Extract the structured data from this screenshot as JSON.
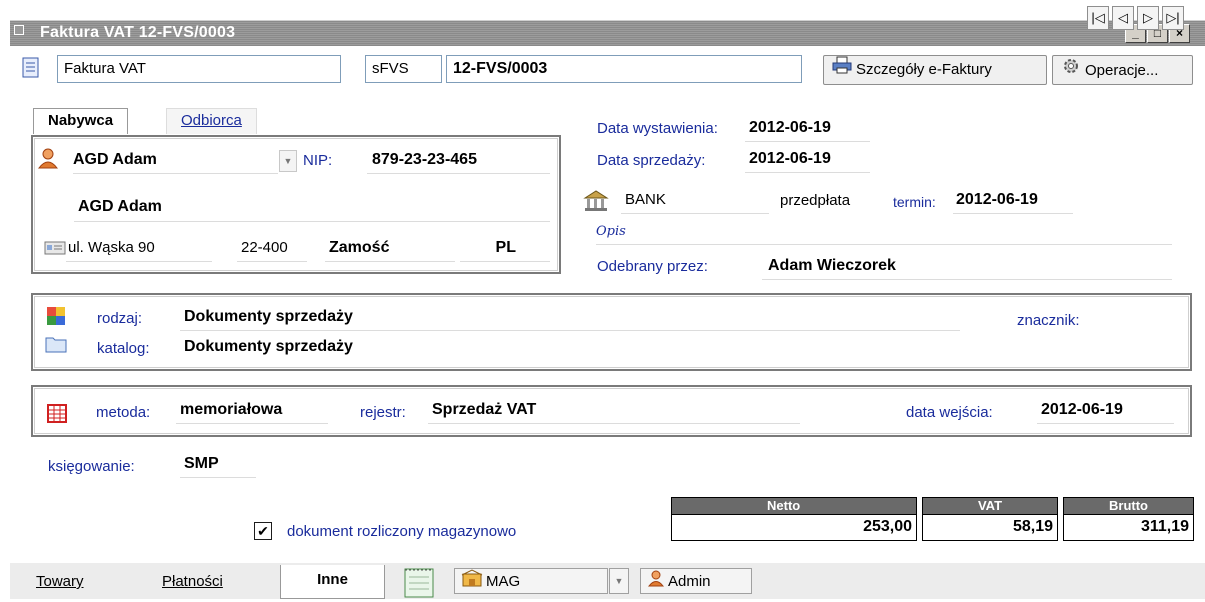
{
  "window": {
    "title": "Faktura VAT 12-FVS/0003",
    "buttons": [
      "_",
      "□",
      "×"
    ]
  },
  "toolbar": {
    "doc_type": "Faktura VAT",
    "series": "sFVS",
    "number": "12-FVS/0003",
    "efaktura_label": "Szczegóły e-Faktury",
    "operations_label": "Operacje..."
  },
  "party_tabs": [
    "Nabywca",
    "Odbiorca"
  ],
  "buyer": {
    "name_select": "AGD Adam",
    "nip_label": "NIP:",
    "nip": "879-23-23-465",
    "full_name": "AGD Adam",
    "street": "ul. Wąska 90",
    "postal": "22-400",
    "city": "Zamość",
    "country": "PL"
  },
  "dates": {
    "issue_label": "Data wystawienia:",
    "issue": "2012-06-19",
    "sale_label": "Data sprzedaży:",
    "sale": "2012-06-19"
  },
  "payment": {
    "method": "BANK",
    "type": "przedpłata",
    "term_label": "termin:",
    "term": "2012-06-19",
    "opis_label": "Opis",
    "received_label": "Odebrany przez:",
    "received_by": "Adam Wieczorek"
  },
  "classification": {
    "kind_label": "rodzaj:",
    "kind": "Dokumenty sprzedaży",
    "catalog_label": "katalog:",
    "catalog": "Dokumenty sprzedaży",
    "tag_label": "znacznik:"
  },
  "registry": {
    "method_label": "metoda:",
    "method": "memoriałowa",
    "register_label": "rejestr:",
    "register": "Sprzedaż VAT",
    "entry_date_label": "data wejścia:",
    "entry_date": "2012-06-19"
  },
  "posting": {
    "label": "księgowanie:",
    "value": "SMP"
  },
  "warehouse_check": {
    "label": "dokument rozliczony magazynowo",
    "checked": true
  },
  "totals": {
    "netto_label": "Netto",
    "netto": "253,00",
    "vat_label": "VAT",
    "vat": "58,19",
    "brutto_label": "Brutto",
    "brutto": "311,19"
  },
  "bottom_tabs": [
    "Towary",
    "Płatności",
    "Inne"
  ],
  "active_bottom_tab": "Inne",
  "bottom": {
    "warehouse": "MAG",
    "user": "Admin"
  },
  "nav_buttons": [
    "first",
    "prev",
    "next",
    "last"
  ]
}
